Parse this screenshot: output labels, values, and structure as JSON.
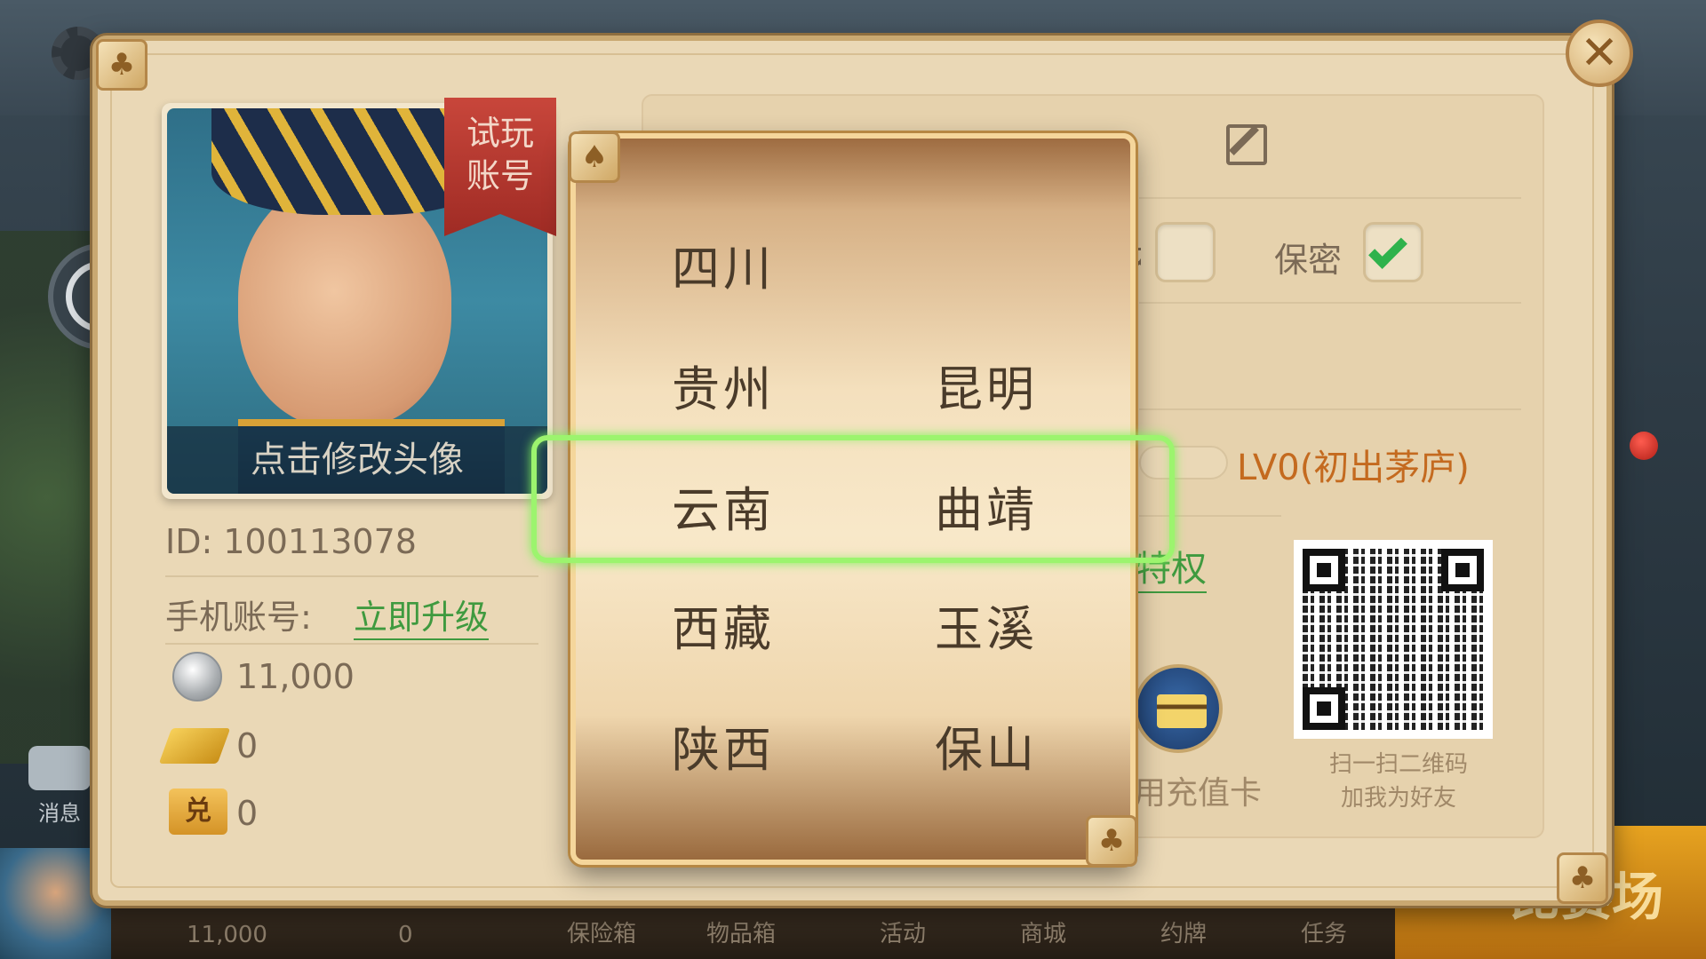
{
  "background": {
    "message_label": "消息",
    "bottom_coin": "11,000",
    "bottom_gold": "0",
    "bottom_menu": [
      "保险箱",
      "物品箱",
      "活动",
      "商城",
      "约牌",
      "任务"
    ],
    "match_button": "比赛场"
  },
  "profile": {
    "trial_badge": "试玩账号",
    "avatar_caption": "点击修改头像",
    "id_text": "ID: 100113078",
    "phone_label": "手机账号:",
    "upgrade_link": "立即升级",
    "coins": "11,000",
    "gold": "0",
    "exchange_icon_text": "兑",
    "exchange": "0",
    "gender_female_label": "女",
    "secret_label": "保密",
    "level": "LV0(初出茅庐)",
    "privilege_link": "特权",
    "recharge_card": "用充值卡",
    "qr_caption_line1": "扫一扫二维码",
    "qr_caption_line2": "加我为好友"
  },
  "picker": {
    "provinces": [
      "四川",
      "贵州",
      "云南",
      "西藏",
      "陕西"
    ],
    "cities": [
      "",
      "昆明",
      "曲靖",
      "玉溪",
      "保山"
    ],
    "selected_province": "云南",
    "selected_city": "曲靖"
  },
  "colors": {
    "highlight": "#9cf46e",
    "link_green": "#3f9a3f",
    "level_orange": "#c46a1f",
    "panel_bg": "#ead8b6"
  },
  "icons": {
    "close": "close-icon",
    "edit": "edit-icon",
    "check": "check-icon",
    "clubs": "clubs-icon",
    "spades": "spades-icon"
  }
}
